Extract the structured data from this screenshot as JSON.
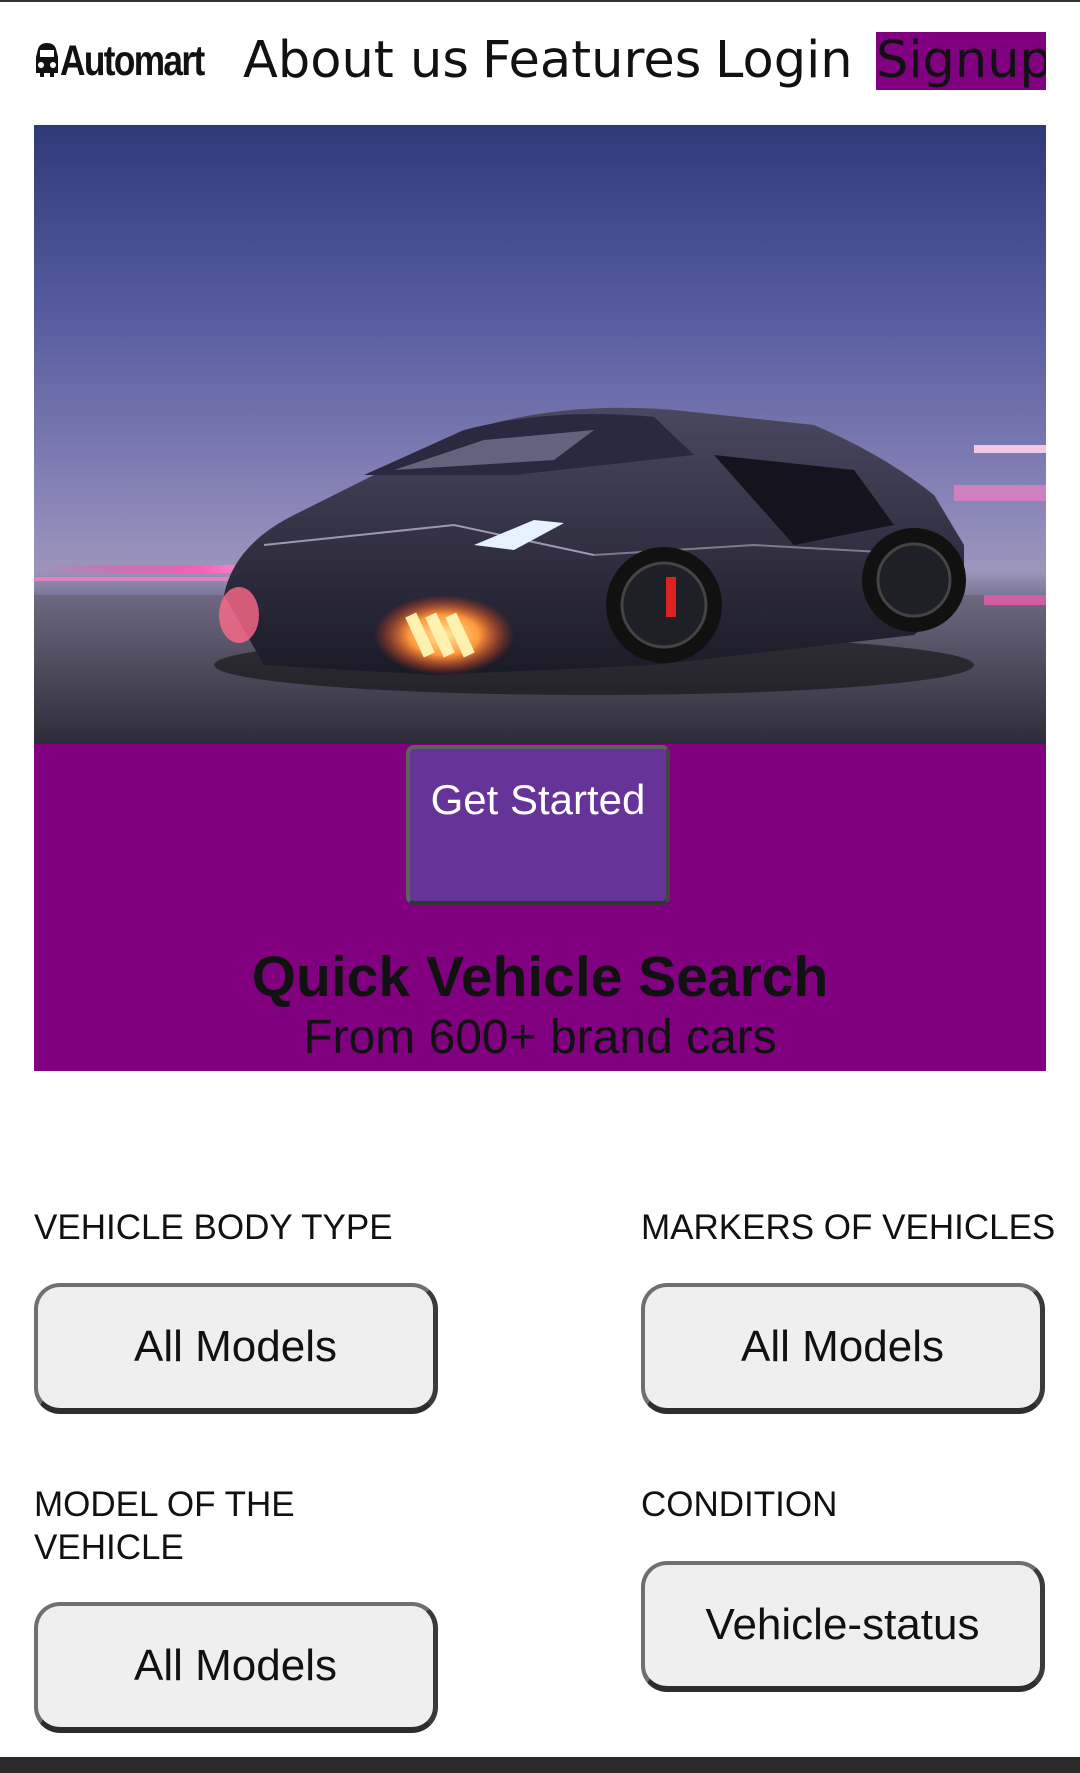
{
  "nav": {
    "brand": "Automart",
    "about": "About us",
    "features": "Features",
    "login": "Login",
    "signup": "Signup"
  },
  "hero": {
    "image": "black-sports-car"
  },
  "panel": {
    "get_started": "Get Started",
    "title": "Quick Vehicle Search",
    "subtitle": "From 600+ brand cars"
  },
  "search": {
    "body_type": {
      "label": "VEHICLE BODY TYPE",
      "value": "All Models"
    },
    "markers": {
      "label": "MARKERS OF VEHICLES",
      "value": "All Models"
    },
    "model": {
      "label": "MODEL OF THE VEHICLE",
      "value": "All Models"
    },
    "condition": {
      "label": "CONDITION",
      "value": "Vehicle-status"
    }
  },
  "colors": {
    "accent": "#800080",
    "button": "#663399"
  }
}
